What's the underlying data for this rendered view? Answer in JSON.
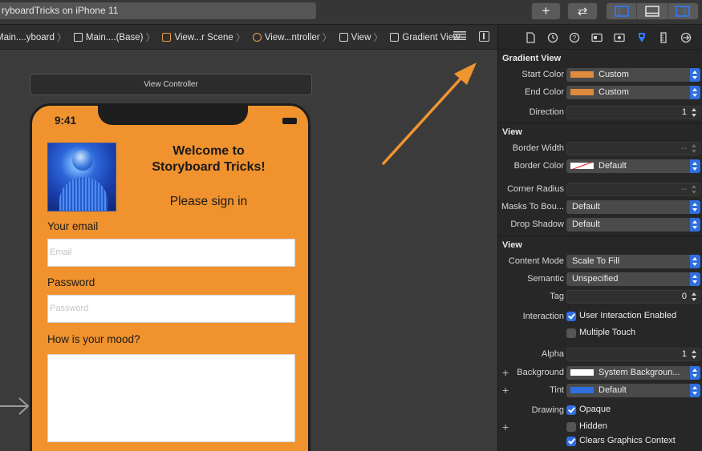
{
  "toolbar": {
    "scheme": "ryboardTricks on iPhone 11",
    "add_symbol": "+",
    "swap_symbol": "⇄"
  },
  "jumpbar": {
    "crumbs": [
      "Main....yboard",
      "Main....(Base)",
      "View...r Scene",
      "View...ntroller",
      "View",
      "Gradient View"
    ]
  },
  "canvas": {
    "scene_title": "View Controller",
    "status_time": "9:41",
    "welcome": "Welcome to\nStoryboard Tricks!",
    "signin": "Please sign in",
    "email_label": "Your email",
    "email_placeholder": "Email",
    "password_label": "Password",
    "password_placeholder": "Password",
    "mood_label": "How is your mood?",
    "accent_color": "#f0922e"
  },
  "inspector": {
    "gradient": {
      "title": "Gradient View",
      "start_label": "Start Color",
      "start_value": "Custom",
      "start_color": "#e08a3c",
      "end_label": "End Color",
      "end_value": "Custom",
      "end_color": "#e08a3c",
      "direction_label": "Direction",
      "direction_value": "1"
    },
    "view1": {
      "title": "View",
      "border_width_label": "Border Width",
      "border_width_value": "--",
      "border_color_label": "Border Color",
      "border_color_value": "Default",
      "corner_radius_label": "Corner Radius",
      "corner_radius_value": "--",
      "masks_label": "Masks To Bou...",
      "masks_value": "Default",
      "shadow_label": "Drop Shadow",
      "shadow_value": "Default"
    },
    "view2": {
      "title": "View",
      "content_mode_label": "Content Mode",
      "content_mode_value": "Scale To Fill",
      "semantic_label": "Semantic",
      "semantic_value": "Unspecified",
      "tag_label": "Tag",
      "tag_value": "0",
      "interaction_label": "Interaction",
      "user_interaction": "User Interaction Enabled",
      "multiple_touch": "Multiple Touch",
      "alpha_label": "Alpha",
      "alpha_value": "1",
      "background_label": "Background",
      "background_value": "System Backgroun...",
      "background_color": "#ffffff",
      "tint_label": "Tint",
      "tint_value": "Default",
      "tint_color": "#2f6fe0",
      "drawing_label": "Drawing",
      "opaque": "Opaque",
      "hidden": "Hidden",
      "clears": "Clears Graphics Context",
      "plus_symbol": "+"
    }
  }
}
